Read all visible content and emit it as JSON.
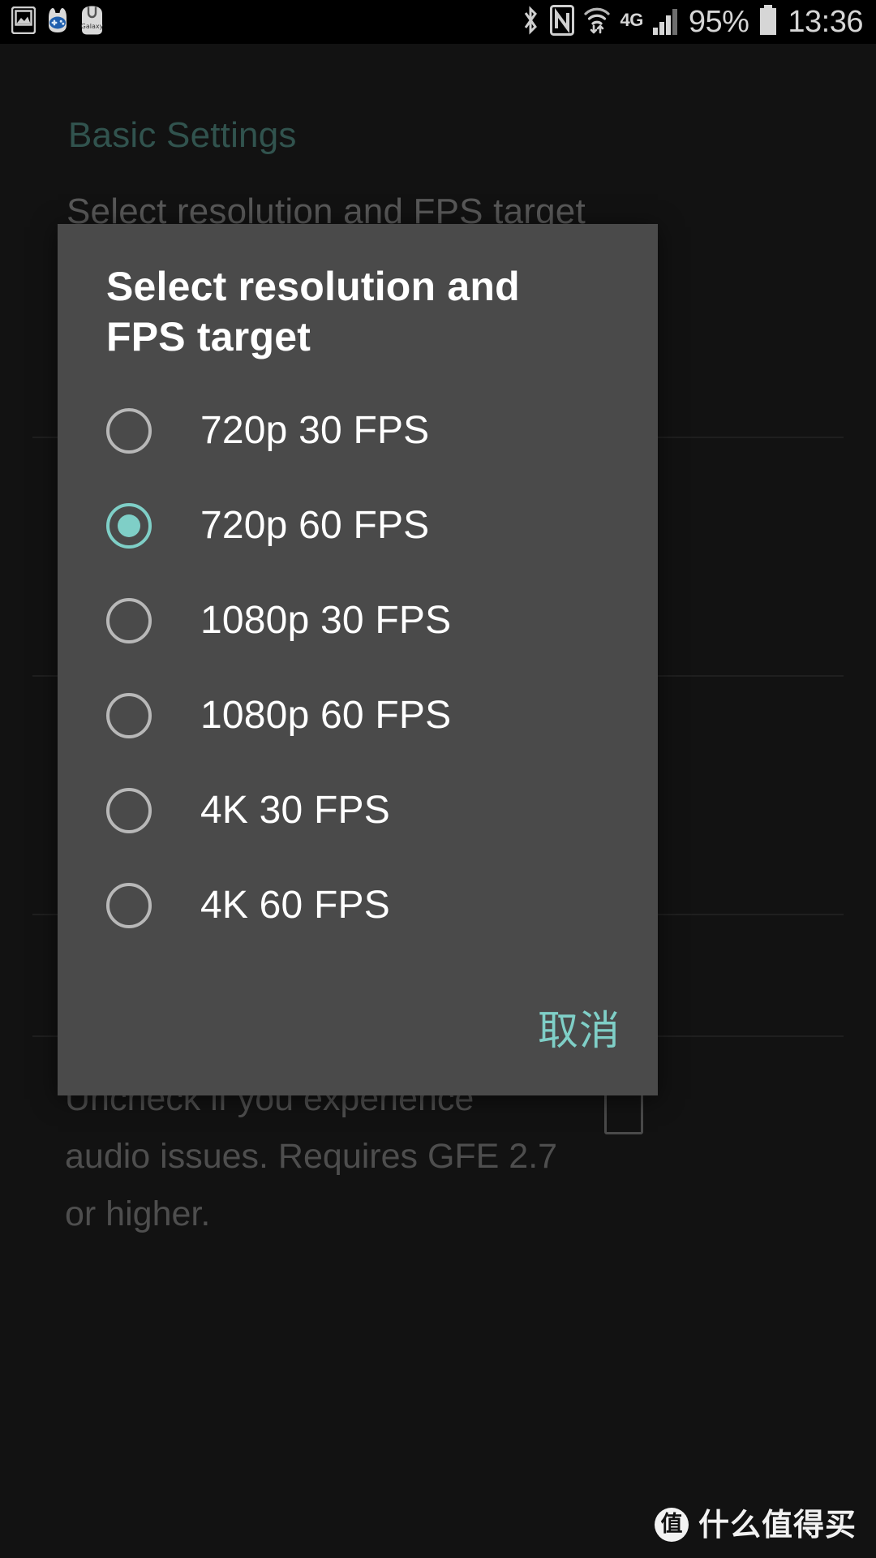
{
  "status_bar": {
    "left_icons": [
      {
        "name": "gallery-image-icon",
        "label": "screenshot"
      },
      {
        "name": "game-controller-icon",
        "label": "game-launcher"
      },
      {
        "name": "galaxy-app-icon",
        "label": "Galaxy"
      }
    ],
    "right_icons": [
      {
        "name": "bluetooth-icon"
      },
      {
        "name": "nfc-icon"
      },
      {
        "name": "wifi-transfer-icon"
      }
    ],
    "network_type": "4G",
    "signal_bars_filled": 3,
    "signal_bars_total": 4,
    "battery_percent": "95%",
    "battery_level": 95,
    "clock": "13:36"
  },
  "background_page": {
    "section_title": "Basic Settings",
    "preference_title": "Select resolution and FPS target",
    "preference_description": "Uncheck if you experience audio issues. Requires GFE 2.7 or higher.",
    "checkbox_checked": false
  },
  "dialog": {
    "title": "Select resolution and FPS target",
    "selected_index": 1,
    "options": [
      {
        "label": "720p 30 FPS",
        "selected": false
      },
      {
        "label": "720p 60 FPS",
        "selected": true
      },
      {
        "label": "1080p 30 FPS",
        "selected": false
      },
      {
        "label": "1080p 60 FPS",
        "selected": false
      },
      {
        "label": "4K 30 FPS",
        "selected": false
      },
      {
        "label": "4K 60 FPS",
        "selected": false
      }
    ],
    "cancel_label": "取消"
  },
  "watermark": {
    "badge": "值",
    "text": "什么值得买"
  },
  "colors": {
    "accent_teal": "#7fcfc7",
    "section_title_teal": "#31534e",
    "dialog_background": "#4a4a4a",
    "page_background": "#121212",
    "status_bar_background": "#000000",
    "radio_unselected": "#b8b8b8",
    "text_primary": "#ffffff",
    "text_dim": "#4e4e4e"
  }
}
